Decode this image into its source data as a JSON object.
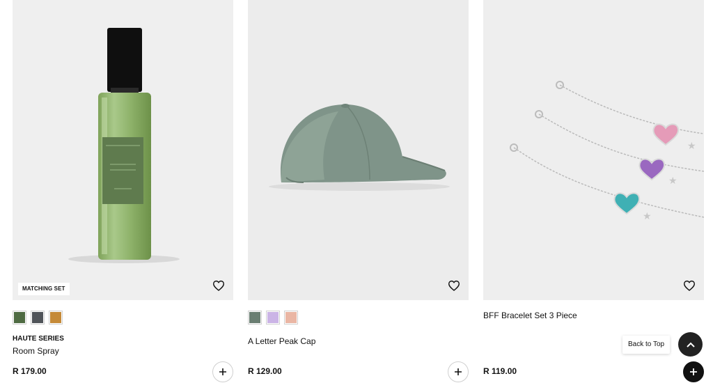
{
  "products": [
    {
      "badge": "MATCHING SET",
      "brand": "HAUTE SERIES",
      "name": "Room Spray",
      "price": "R 179.00",
      "swatches": [
        {
          "color": "#4f6b43"
        },
        {
          "color": "#505459"
        },
        {
          "color": "#c58a38"
        }
      ]
    },
    {
      "name": "A Letter Peak Cap",
      "price": "R 129.00",
      "swatches": [
        {
          "color": "#6a7e72"
        },
        {
          "color": "#cbb4e6"
        },
        {
          "color": "#eab6a4"
        }
      ]
    },
    {
      "name": "BFF Bracelet Set 3 Piece",
      "price": "R 119.00"
    }
  ],
  "back_to_top": {
    "label": "Back to Top"
  },
  "icons": {
    "wishlist": "heart-outline-icon",
    "add": "plus-icon",
    "back_to_top": "chevron-up-icon"
  }
}
